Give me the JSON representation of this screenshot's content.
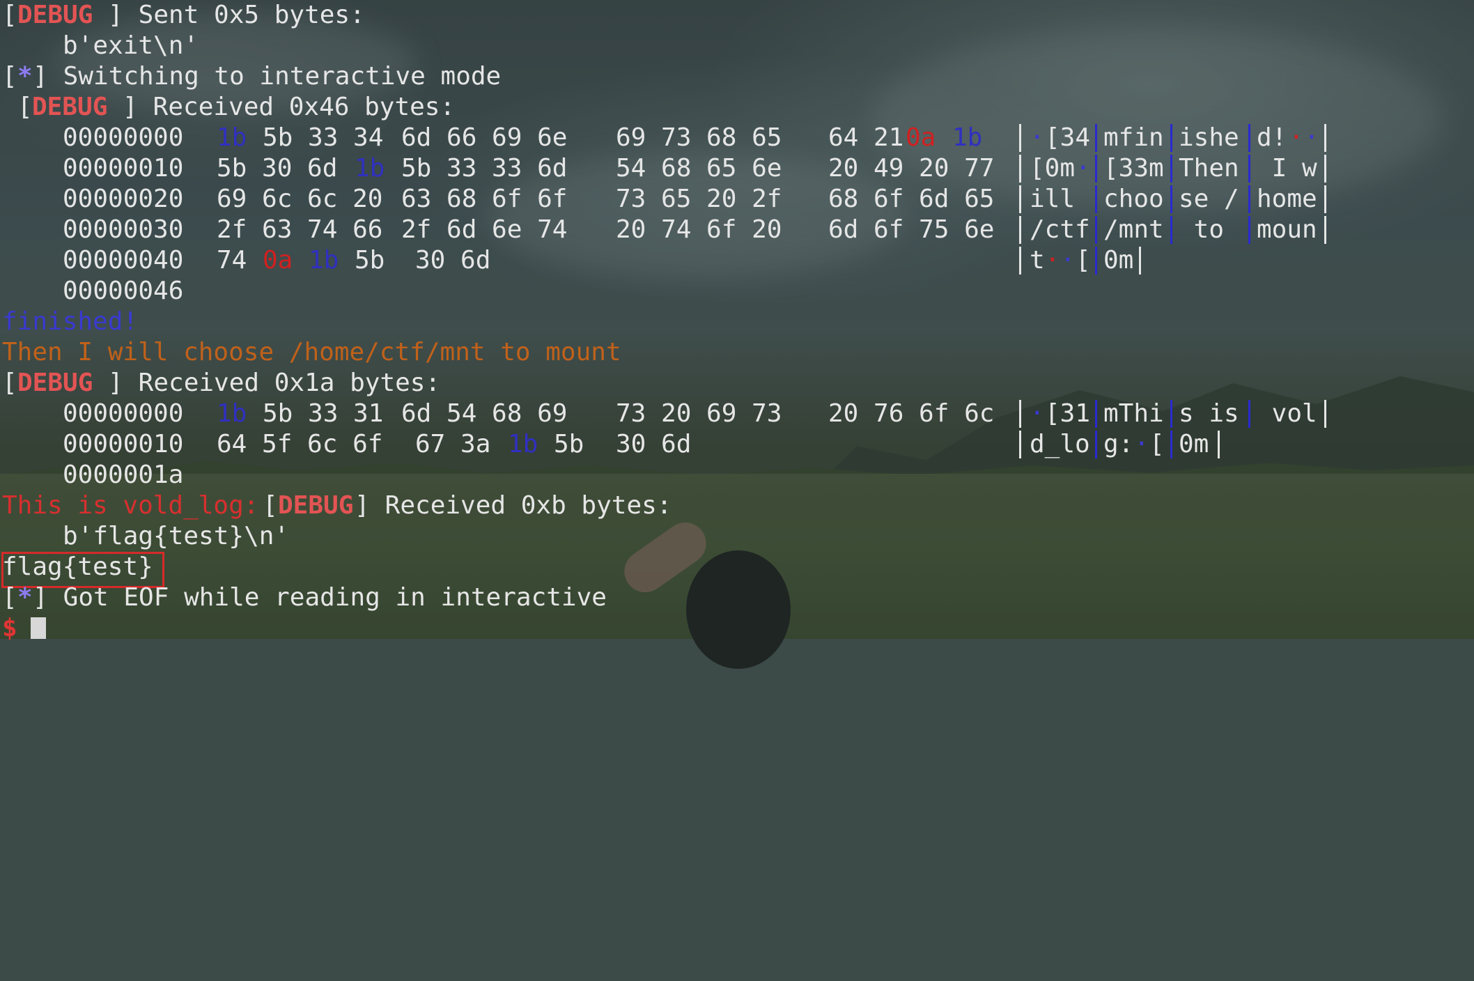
{
  "terminal": {
    "line1": {
      "open": "[",
      "tag": "DEBUG",
      "close": "]",
      "text": " Sent 0x5 bytes:"
    },
    "line2": "b'exit\\n'",
    "line3": {
      "open": "[",
      "star": "*",
      "close": "]",
      "text": " Switching to interactive mode"
    },
    "line4": {
      "open": "[",
      "tag": "DEBUG",
      "close": "]",
      "text": " Received 0x46 bytes:"
    },
    "hexdump1": {
      "rows": [
        {
          "offset": "00000000",
          "g1": [
            "1b",
            "5b 33 34"
          ],
          "g2": "6d 66 69 6e",
          "g3": "69 73 68 65",
          "g4a": "64 21",
          "g4b": "0a",
          "g4c": "1b"
        },
        {
          "offset": "00000010",
          "g1a": "5b 30 6d",
          "g1b": "1b",
          "g2": "5b 33 33 6d",
          "g3": "54 68 65 6e",
          "g4": "20 49 20 77"
        },
        {
          "offset": "00000020",
          "g1": "69 6c 6c 20",
          "g2": "63 68 6f 6f",
          "g3": "73 65 20 2f",
          "g4": "68 6f 6d 65"
        },
        {
          "offset": "00000030",
          "g1": "2f 63 74 66",
          "g2": "2f 6d 6e 74",
          "g3": "20 74 6f 20",
          "g4": "6d 6f 75 6e"
        },
        {
          "offset": "00000040",
          "g1a": "74",
          "g1b": "0a",
          "g1c": "1b",
          "g1d": "5b",
          "g2": "30 6d"
        }
      ],
      "end": "00000046",
      "ascii": [
        [
          "[34",
          "mfin",
          "ishe",
          "d!"
        ],
        [
          "[0m",
          "[33m",
          "Then",
          " I w"
        ],
        [
          "ill ",
          "choo",
          "se /",
          "home"
        ],
        [
          "/ctf",
          "/mnt",
          " to ",
          "moun"
        ],
        [
          "t",
          "[",
          "0m"
        ]
      ]
    },
    "finished": "finished!",
    "then_line": "Then I will choose /home/ctf/mnt to mount",
    "line_recv2": {
      "open": "[",
      "tag": "DEBUG",
      "close": "]",
      "text": " Received 0x1a bytes:"
    },
    "hexdump2": {
      "rows": [
        {
          "offset": "00000000",
          "g1a": "1b",
          "g1b": "5b 33 31",
          "g2": "6d 54 68 69",
          "g3": "73 20 69 73",
          "g4": "20 76 6f 6c"
        },
        {
          "offset": "00000010",
          "g1": "64 5f 6c 6f",
          "g2a": "67 3a",
          "g2b": "1b",
          "g2c": "5b",
          "g3": "30 6d"
        }
      ],
      "end": "0000001a",
      "ascii": [
        [
          "[31",
          "mThi",
          "s is",
          " vol"
        ],
        [
          "d_lo",
          "g:",
          "[",
          "0m"
        ]
      ]
    },
    "vold_line": {
      "red": "This is vold_log:",
      "open": "[",
      "tag": "DEBUG",
      "close": "]",
      "text": " Received 0xb bytes:"
    },
    "flag_bytes": "b'flag{test}\\n'",
    "flag": "flag{test}",
    "eof": {
      "open": "[",
      "star": "*",
      "close": "]",
      "text": " Got EOF while reading in interactive"
    },
    "prompt": "$",
    "dot": "·"
  },
  "colors": {
    "debug": "#e35454",
    "escape_byte": "#3030c0",
    "newline_byte": "#d02020",
    "finished": "#3a3ad0",
    "orange": "#c0611a",
    "highlight_box": "#d62a2a"
  }
}
